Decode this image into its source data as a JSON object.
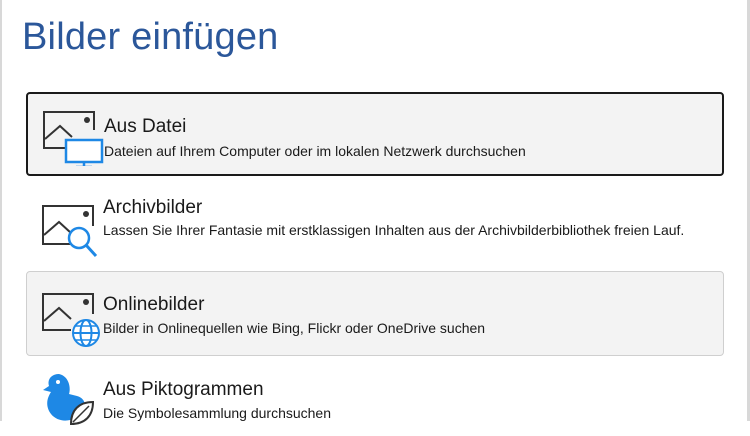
{
  "dialog": {
    "title": "Bilder einfügen"
  },
  "options": [
    {
      "title": "Aus Datei",
      "description": "Dateien auf Ihrem Computer oder im lokalen Netzwerk durchsuchen",
      "icon": "picture-computer-icon",
      "state": "selected"
    },
    {
      "title": "Archivbilder",
      "description": "Lassen Sie Ihrer Fantasie mit erstklassigen Inhalten aus der Archivbilderbibliothek freien Lauf.",
      "icon": "picture-search-icon",
      "state": "normal"
    },
    {
      "title": "Onlinebilder",
      "description": "Bilder in Onlinequellen wie Bing, Flickr oder OneDrive suchen",
      "icon": "picture-globe-icon",
      "state": "hover"
    },
    {
      "title": "Aus Piktogrammen",
      "description": "Die Symbolesammlung durchsuchen",
      "icon": "bird-leaf-icon",
      "state": "normal"
    }
  ],
  "colors": {
    "title": "#2b579a",
    "accent_blue": "#1e88e5",
    "selected_border": "#1a1a1a",
    "hover_background": "#f3f3f3"
  }
}
